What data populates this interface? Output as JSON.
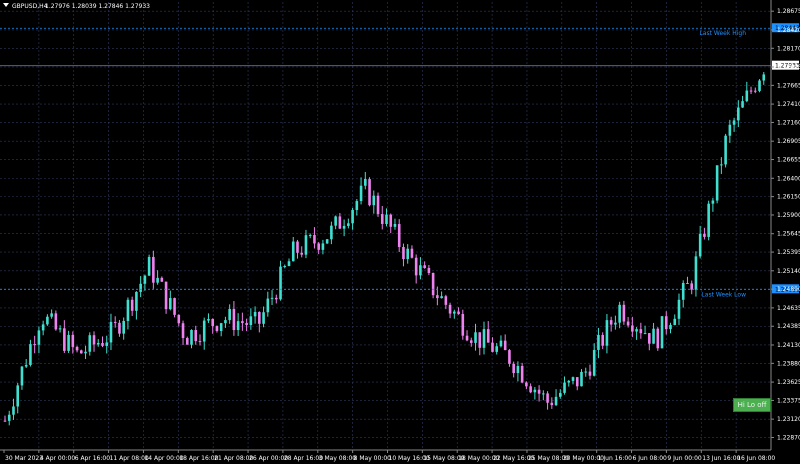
{
  "header": {
    "symbol": "GBPUSD,H4",
    "ohlc": "1.27976 1.28039 1.27846 1.27933"
  },
  "price_axis": {
    "ticks": [
      "1.28675",
      "1.28420",
      "1.28170",
      "1.27915",
      "1.27665",
      "1.27410",
      "1.27160",
      "1.26905",
      "1.26655",
      "1.26400",
      "1.26150",
      "1.25900",
      "1.25645",
      "1.25395",
      "1.25140",
      "1.24890",
      "1.24635",
      "1.24385",
      "1.24130",
      "1.23880",
      "1.23625",
      "1.23375",
      "1.23120",
      "1.22870"
    ],
    "current_price": "1.27933",
    "last_week_high_price": "1.28443",
    "last_week_low_price": "1.24888"
  },
  "time_axis": {
    "labels": [
      "30 Mar 2023",
      "4 Apr 00:00",
      "6 Apr 16:00",
      "11 Apr 08:00",
      "14 Apr 00:00",
      "18 Apr 16:00",
      "21 Apr 08:00",
      "26 Apr 00:00",
      "28 Apr 16:00",
      "3 May 08:00",
      "8 May 00:00",
      "10 May 16:00",
      "15 May 08:00",
      "18 May 00:00",
      "22 May 16:00",
      "25 May 08:00",
      "30 May 00:00",
      "1 Jun 16:00",
      "6 Jun 08:00",
      "9 Jun 00:00",
      "13 Jun 16:00",
      "16 Jun 08:00"
    ]
  },
  "levels": {
    "last_week_high_label": "Last Week High",
    "last_week_low_label": "Last Week Low"
  },
  "hide_button_label": "Hi Lo off",
  "colors": {
    "background": "#000000",
    "bull": "#40e0d0",
    "bear": "#ee82ee",
    "grid": "#2e3a5c",
    "level": "#1e90ff",
    "current_line": "#6a6aa6"
  },
  "chart_data": {
    "type": "candlestick",
    "symbol": "GBPUSD",
    "timeframe": "H4",
    "ylim": [
      1.227,
      1.288
    ],
    "x": [
      "30 Mar 2023",
      "4 Apr 00:00",
      "6 Apr 16:00",
      "11 Apr 08:00",
      "14 Apr 00:00",
      "18 Apr 16:00",
      "21 Apr 08:00",
      "26 Apr 00:00",
      "28 Apr 16:00",
      "3 May 08:00",
      "8 May 00:00",
      "10 May 16:00",
      "15 May 08:00",
      "18 May 00:00",
      "22 May 16:00",
      "25 May 08:00",
      "30 May 00:00",
      "1 Jun 16:00",
      "6 Jun 08:00",
      "9 Jun 00:00",
      "13 Jun 16:00",
      "16 Jun 08:00"
    ],
    "close": [
      1.231,
      1.2455,
      1.24,
      1.243,
      1.252,
      1.2425,
      1.245,
      1.244,
      1.254,
      1.2565,
      1.2625,
      1.2545,
      1.248,
      1.2425,
      1.2395,
      1.2335,
      1.237,
      1.2465,
      1.242,
      1.25,
      1.27,
      1.2793
    ],
    "levels": [
      {
        "name": "Last Week High",
        "value": 1.28443
      },
      {
        "name": "Last Week Low",
        "value": 1.24888
      }
    ],
    "current": 1.27933
  }
}
